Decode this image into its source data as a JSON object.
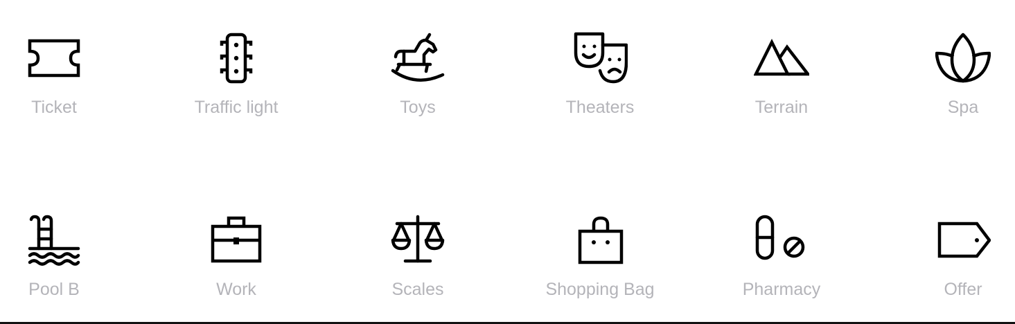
{
  "colors": {
    "icon_stroke": "#000000",
    "label_text": "#b4b4b9",
    "background": "#ffffff",
    "bottom_rule": "#111111"
  },
  "icons": [
    {
      "label": "Ticket",
      "icon": "ticket-icon"
    },
    {
      "label": "Traffic light",
      "icon": "traffic-light-icon"
    },
    {
      "label": "Toys",
      "icon": "rocking-horse-icon"
    },
    {
      "label": "Theaters",
      "icon": "theater-masks-icon"
    },
    {
      "label": "Terrain",
      "icon": "mountains-icon"
    },
    {
      "label": "Spa",
      "icon": "lotus-icon"
    },
    {
      "label": "Pool B",
      "icon": "pool-ladder-icon"
    },
    {
      "label": "Work",
      "icon": "briefcase-icon"
    },
    {
      "label": "Scales",
      "icon": "balance-scale-icon"
    },
    {
      "label": "Shopping Bag",
      "icon": "shopping-bag-icon"
    },
    {
      "label": "Pharmacy",
      "icon": "pill-icon"
    },
    {
      "label": "Offer",
      "icon": "price-tag-icon"
    }
  ]
}
